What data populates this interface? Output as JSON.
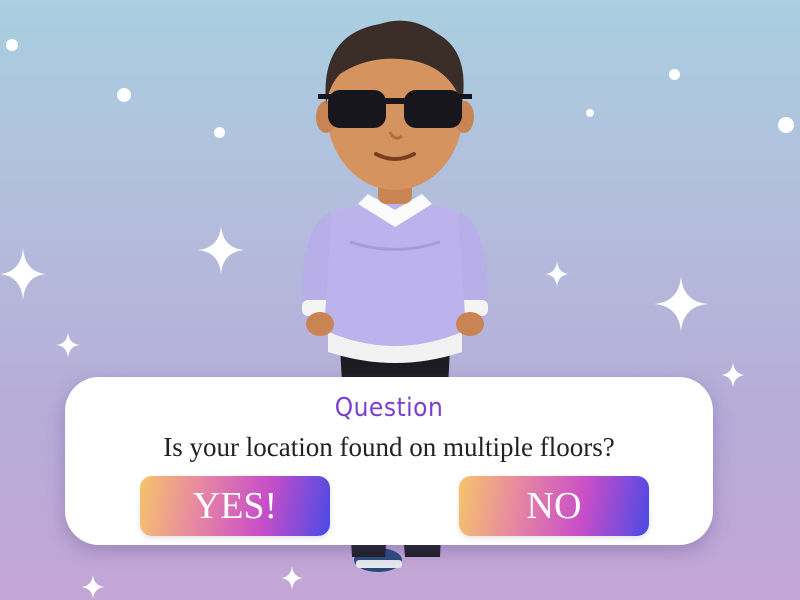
{
  "dialog": {
    "title": "Question",
    "question": "Is your location found on multiple floors?",
    "yes_label": "YES!",
    "no_label": "NO"
  },
  "colors": {
    "title": "#7b3fd0",
    "button_gradient": [
      "#f6c46a",
      "#c84ec8",
      "#4a4ae6"
    ]
  }
}
